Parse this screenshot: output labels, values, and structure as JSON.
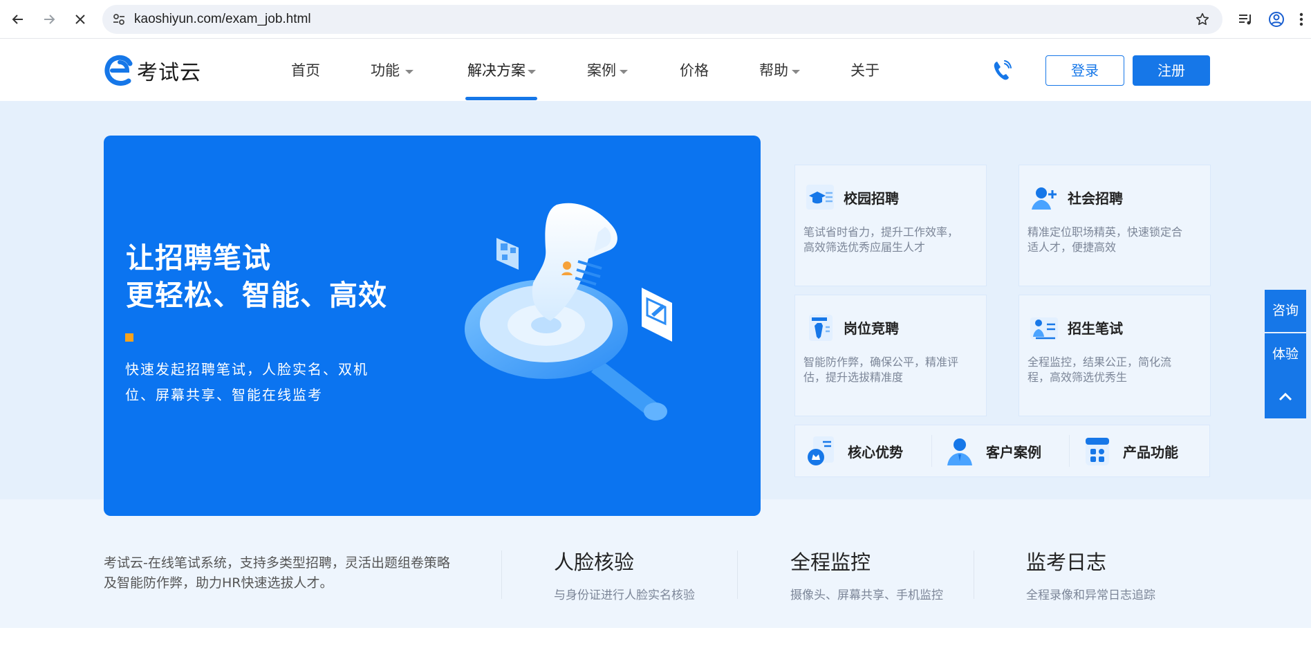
{
  "browser": {
    "url": "kaoshiyun.com/exam_job.html"
  },
  "site": {
    "logo_text": "考试云",
    "nav": [
      {
        "label": "首页",
        "has_caret": false
      },
      {
        "label": "功能",
        "has_caret": true
      },
      {
        "label": "解决方案",
        "has_caret": true,
        "active": true
      },
      {
        "label": "案例",
        "has_caret": true
      },
      {
        "label": "价格",
        "has_caret": false
      },
      {
        "label": "帮助",
        "has_caret": true
      },
      {
        "label": "关于",
        "has_caret": false
      }
    ],
    "login_label": "登录",
    "register_label": "注册",
    "accent_color": "#1677e8"
  },
  "hero": {
    "title_line1": "让招聘笔试",
    "title_line2": "更轻松、智能、高效",
    "desc_line1": "快速发起招聘笔试，人脸实名、双机",
    "desc_line2": "位、屏幕共享、智能在线监考"
  },
  "features": [
    {
      "title": "校园招聘",
      "desc_line1": "笔试省时省力，提升工作效率，",
      "desc_line2": "高效筛选优秀应届生人才",
      "icon": "graduate-icon"
    },
    {
      "title": "社会招聘",
      "desc_line1": "精准定位职场精英，快速锁定合",
      "desc_line2": "适人才，便捷高效",
      "icon": "add-person-icon"
    },
    {
      "title": "岗位竞聘",
      "desc_line1": "智能防作弊，确保公平，精准评",
      "desc_line2": "估，提升选拔精准度",
      "icon": "tie-icon"
    },
    {
      "title": "招生笔试",
      "desc_line1": "全程监控，结果公正，简化流",
      "desc_line2": "程，高效筛选优秀生",
      "icon": "student-icon"
    }
  ],
  "quick_links": [
    {
      "label": "核心优势",
      "icon": "crown-doc-icon"
    },
    {
      "label": "客户案例",
      "icon": "person-icon"
    },
    {
      "label": "产品功能",
      "icon": "grid-app-icon"
    }
  ],
  "float_buttons": {
    "consult": "咨询",
    "trial": "体验"
  },
  "intro": {
    "line1": "考试云-在线笔试系统，支持多类型招聘，灵活出题组卷策略",
    "line2": "及智能防作弊，助力HR快速选拔人才。"
  },
  "stats": [
    {
      "title": "人脸核验",
      "desc": "与身份证进行人脸实名核验"
    },
    {
      "title": "全程监控",
      "desc": "摄像头、屏幕共享、手机监控"
    },
    {
      "title": "监考日志",
      "desc": "全程录像和异常日志追踪"
    }
  ]
}
